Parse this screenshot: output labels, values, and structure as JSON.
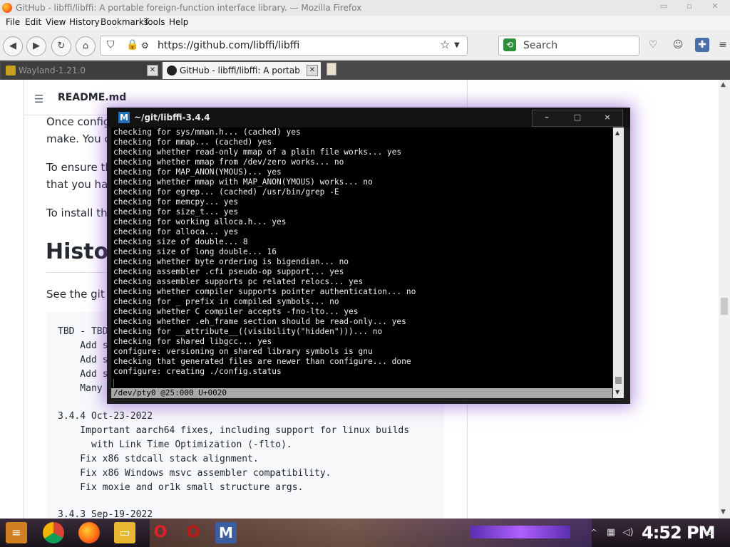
{
  "window": {
    "title": "GitHub - libffi/libffi: A portable foreign-function interface library. — Mozilla Firefox"
  },
  "menu": [
    "File",
    "Edit",
    "View",
    "History",
    "Bookmarks",
    "Tools",
    "Help"
  ],
  "navbar": {
    "url": "https://github.com/libffi/libffi",
    "search_placeholder": "Search"
  },
  "tabs": [
    {
      "label": "Wayland-1.21.0",
      "active": false
    },
    {
      "label": "GitHub - libffi/libffi: A portab",
      "active": true
    }
  ],
  "page": {
    "readme_label": "README.md",
    "para1_line1": "Once config",
    "para1_line2": "make. You ca",
    "para2_line1": "To ensure th",
    "para2_line2": "that you hav",
    "para3": "To install the",
    "history_heading": "Histo",
    "see_git": "See the git lo",
    "code_lines": [
      "TBD - TBD",
      "    Add s",
      "    Add s",
      "    Add s",
      "    Many",
      "",
      "3.4.4 Oct-23-2022",
      "    Important aarch64 fixes, including support for linux builds",
      "      with Link Time Optimization (-flto).",
      "    Fix x86 stdcall stack alignment.",
      "    Fix x86 Windows msvc assembler compatibility.",
      "    Fix moxie and or1k small structure args.",
      "",
      "3.4.3 Sep-19-2022"
    ]
  },
  "terminal": {
    "title": "~/git/libffi-3.4.4",
    "controls": [
      "–",
      "□",
      "×"
    ],
    "lines": [
      "checking for sys/mman.h... (cached) yes",
      "checking for mmap... (cached) yes",
      "checking whether read-only mmap of a plain file works... yes",
      "checking whether mmap from /dev/zero works... no",
      "checking for MAP_ANON(YMOUS)... yes",
      "checking whether mmap with MAP_ANON(YMOUS) works... no",
      "checking for egrep... (cached) /usr/bin/grep -E",
      "checking for memcpy... yes",
      "checking for size_t... yes",
      "checking for working alloca.h... yes",
      "checking for alloca... yes",
      "checking size of double... 8",
      "checking size of long double... 16",
      "checking whether byte ordering is bigendian... no",
      "checking assembler .cfi pseudo-op support... yes",
      "checking assembler supports pc related relocs... yes",
      "checking whether compiler supports pointer authentication... no",
      "checking for _ prefix in compiled symbols... no",
      "checking whether C compiler accepts -fno-lto... yes",
      "checking whether .eh_frame section should be read-only... yes",
      "checking for __attribute__((visibility(\"hidden\")))... no",
      "checking for shared libgcc... yes",
      "configure: versioning on shared library symbols is gnu",
      "checking that generated files are newer than configure... done",
      "configure: creating ./config.status"
    ],
    "status": "/dev/pty0 @25:000  U+0020"
  },
  "taskbar": {
    "clock": "4:52 PM"
  },
  "colors": {
    "terminal_glow": "#7a3cc8",
    "terminal_bg": "#000000",
    "tab_bar": "#4a4a4a"
  }
}
